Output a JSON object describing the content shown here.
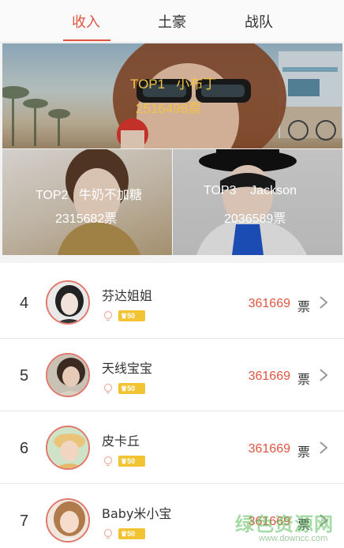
{
  "tabs": [
    {
      "label": "收入",
      "active": true
    },
    {
      "label": "土豪",
      "active": false
    },
    {
      "label": "战队",
      "active": false
    }
  ],
  "top": [
    {
      "rank_label": "TOP1",
      "name": "小布丁",
      "votes": "2516498票"
    },
    {
      "rank_label": "TOP2",
      "name": "牛奶不加糖",
      "votes": "2315682票"
    },
    {
      "rank_label": "TOP3",
      "name": "Jackson",
      "votes": "2036589票"
    }
  ],
  "list": [
    {
      "rank": "4",
      "name": "芬达姐姐",
      "level": "50",
      "votes": "361669",
      "unit": "票"
    },
    {
      "rank": "5",
      "name": "天线宝宝",
      "level": "50",
      "votes": "361669",
      "unit": "票"
    },
    {
      "rank": "6",
      "name": "皮卡丘",
      "level": "50",
      "votes": "361669",
      "unit": "票"
    },
    {
      "rank": "7",
      "name": "Baby米小宝",
      "level": "50",
      "votes": "361669",
      "unit": "票"
    }
  ],
  "colors": {
    "accent": "#e0543f",
    "gold": "#f2c34b",
    "badge": "#f2c434"
  },
  "watermark": {
    "text": "绿色资源网",
    "url": "www.downcc.com"
  }
}
